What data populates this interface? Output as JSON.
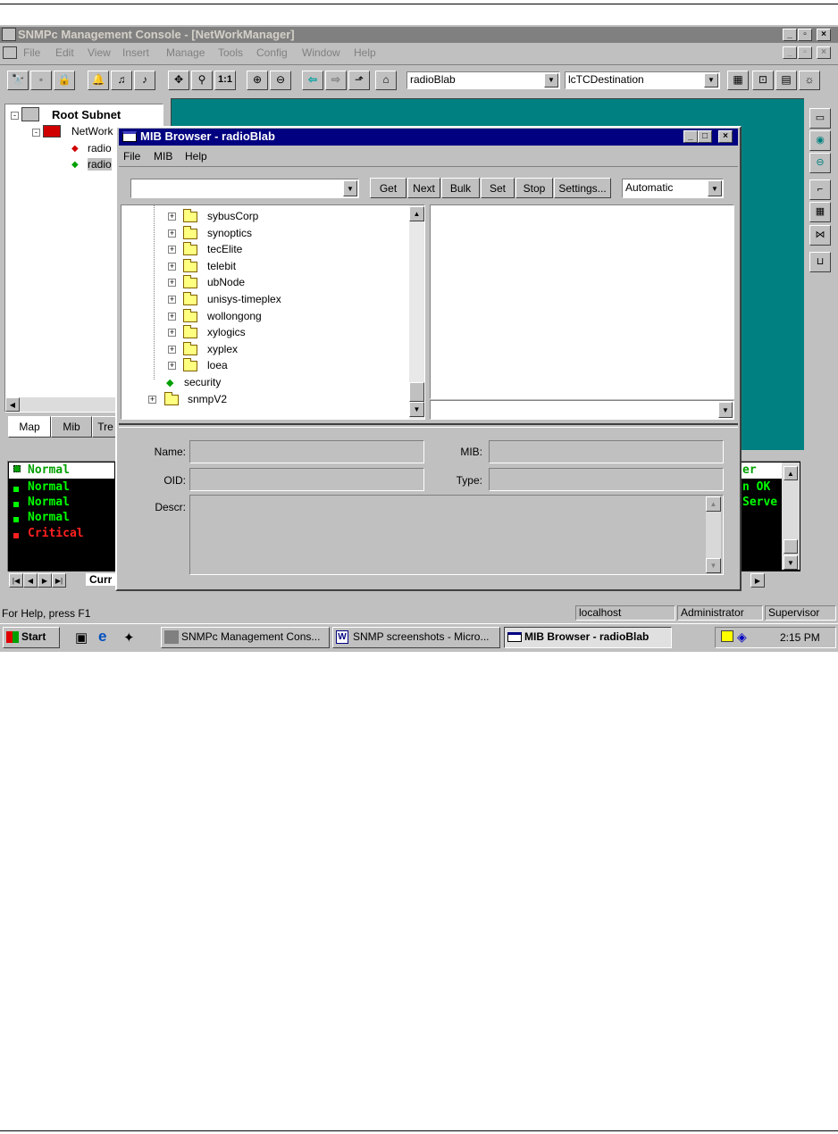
{
  "app": {
    "title": "SNMPc Management Console - [NetWorkManager]",
    "menu": [
      "File",
      "Edit",
      "View",
      "Insert",
      "Manage",
      "Tools",
      "Config",
      "Window",
      "Help"
    ]
  },
  "toolbar": {
    "zoom_label": "1:1",
    "device_combo": "radioBlab",
    "object_combo": "lcTCDestination"
  },
  "left_tree": {
    "root": "Root Subnet",
    "network": "NetWork",
    "items": [
      "radio",
      "radio"
    ]
  },
  "left_tabs": [
    "Map",
    "Mib",
    "Tre"
  ],
  "events": {
    "rows": [
      {
        "status": "Normal",
        "color": "#00ff00"
      },
      {
        "status": "Normal",
        "color": "#00ff00"
      },
      {
        "status": "Normal",
        "color": "#00ff00"
      },
      {
        "status": "Normal",
        "color": "#00ff00"
      },
      {
        "status": "Critical",
        "color": "#ff2020"
      }
    ],
    "right_header": "er",
    "right_rows": [
      "n OK",
      "Serve"
    ],
    "tab": "Curr"
  },
  "mib_browser": {
    "title": "MIB Browser - radioBlab",
    "menu": [
      "File",
      "MIB",
      "Help"
    ],
    "buttons": [
      "Get",
      "Next",
      "Bulk",
      "Set",
      "Stop",
      "Settings..."
    ],
    "mode": "Automatic",
    "tree": [
      "sybusCorp",
      "synoptics",
      "tecElite",
      "telebit",
      "ubNode",
      "unisys-timeplex",
      "wollongong",
      "xylogics",
      "xyplex",
      "loea",
      "security",
      "snmpV2"
    ],
    "fields": {
      "name": "Name:",
      "oid": "OID:",
      "descr": "Descr:",
      "mib": "MIB:",
      "type": "Type:"
    }
  },
  "statusbar": {
    "help": "For Help, press F1",
    "host": "localhost",
    "user": "Administrator",
    "role": "Supervisor"
  },
  "taskbar": {
    "start": "Start",
    "tasks": [
      "SNMPc Management Cons...",
      "SNMP screenshots - Micro...",
      "MIB Browser - radioBlab"
    ],
    "clock": "2:15 PM"
  },
  "colors": {
    "titlebar_active": "#000080",
    "titlebar_inactive": "#808080",
    "desktop": "#008080",
    "event_bg": "#000000"
  }
}
